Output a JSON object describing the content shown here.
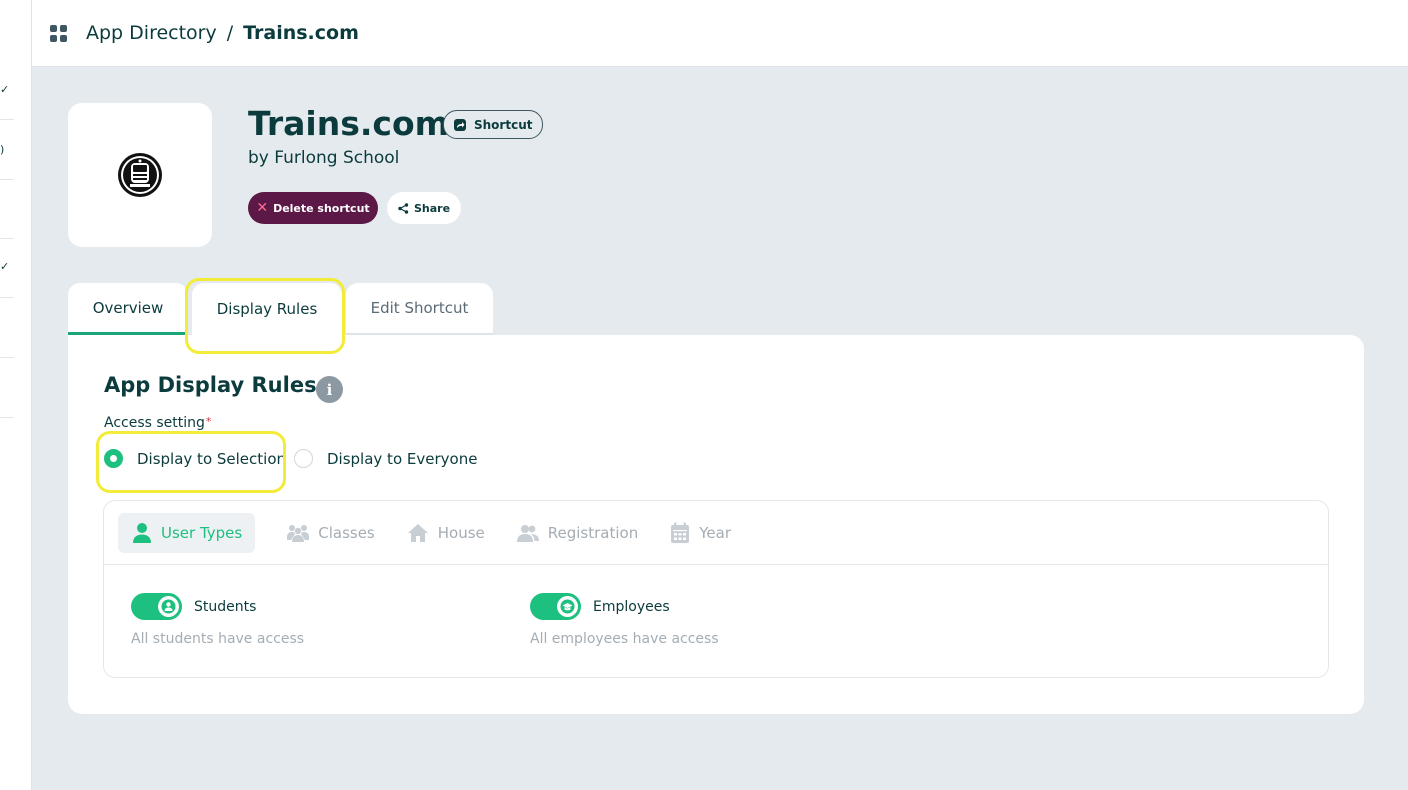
{
  "breadcrumb": {
    "root": "App Directory",
    "separator": "/",
    "current": "Trains.com"
  },
  "app": {
    "title": "Trains.com",
    "badge": "Shortcut",
    "by": "by Furlong School",
    "logo_icon": "train-icon",
    "actions": {
      "delete_label": "Delete shortcut",
      "share_label": "Share"
    }
  },
  "tabs": [
    {
      "label": "Overview",
      "active": true
    },
    {
      "label": "Display Rules",
      "active": false
    },
    {
      "label": "Edit Shortcut",
      "active": false
    }
  ],
  "rules": {
    "title": "App Display Rules",
    "access_label": "Access setting",
    "required_mark": "*",
    "options": [
      {
        "label": "Display to Selection",
        "selected": true
      },
      {
        "label": "Display to Everyone",
        "selected": false
      }
    ],
    "filter_tabs": [
      {
        "label": "User Types",
        "icon": "user-icon",
        "active": true
      },
      {
        "label": "Classes",
        "icon": "group-icon",
        "active": false
      },
      {
        "label": "House",
        "icon": "house-icon",
        "active": false
      },
      {
        "label": "Registration",
        "icon": "people-icon",
        "active": false
      },
      {
        "label": "Year",
        "icon": "calendar-icon",
        "active": false
      }
    ],
    "user_types": [
      {
        "label": "Students",
        "description": "All students have access",
        "enabled": true,
        "icon": "student-icon"
      },
      {
        "label": "Employees",
        "description": "All employees have access",
        "enabled": true,
        "icon": "graduation-cap-icon"
      }
    ]
  },
  "colors": {
    "accent": "#1dc07f",
    "primary_text": "#0b3b3c",
    "delete": "#5c1846",
    "highlight": "#f2ec38"
  }
}
